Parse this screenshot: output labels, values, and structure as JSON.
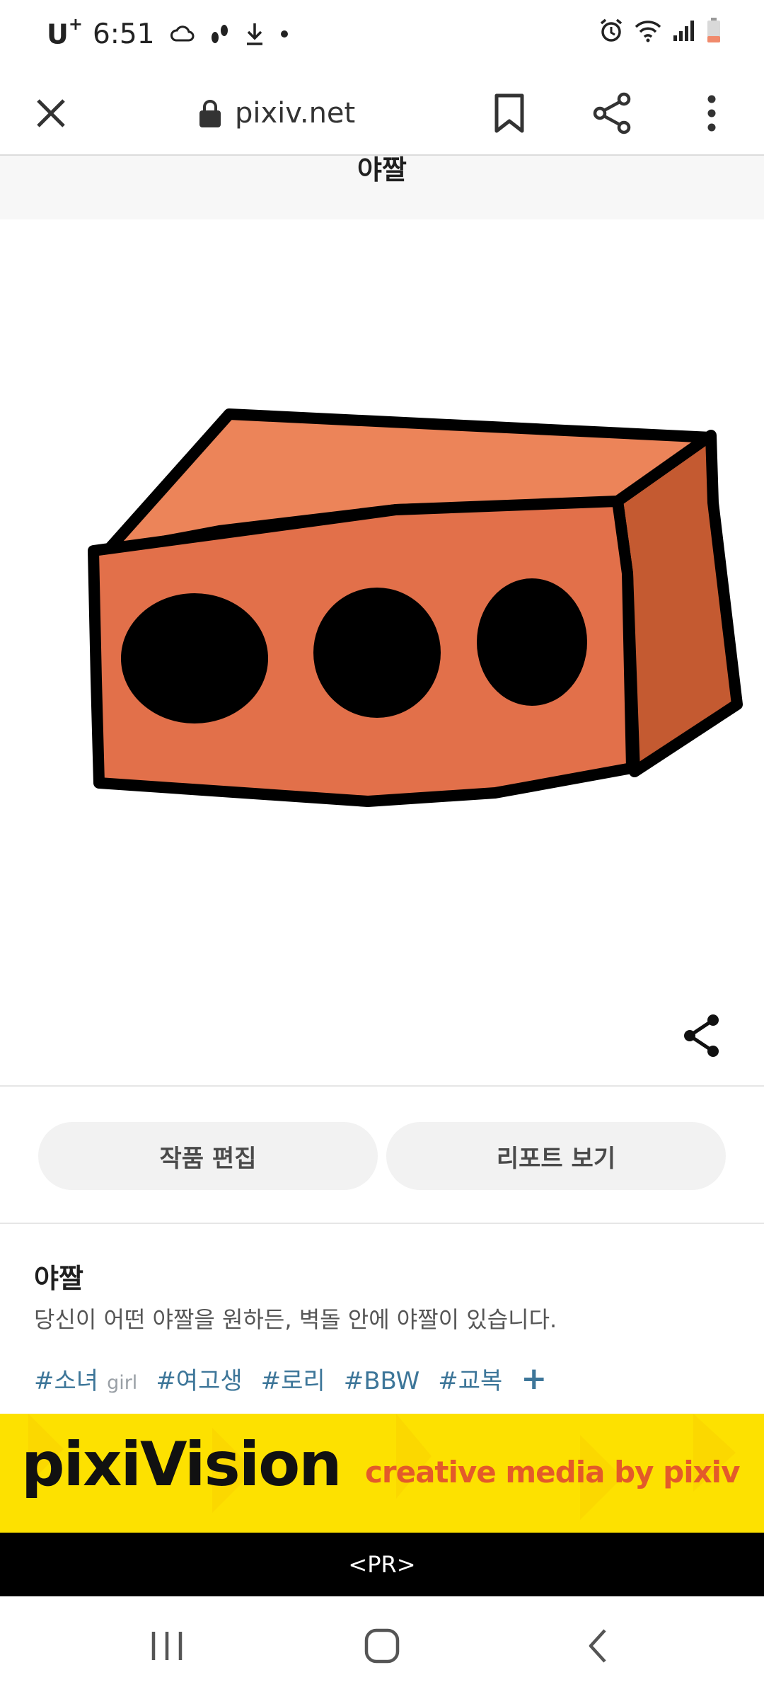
{
  "status_bar": {
    "carrier": "U",
    "carrier_plus": "+",
    "time": "6:51"
  },
  "browser": {
    "url": "pixiv.net",
    "icons": [
      "close-icon",
      "lock-icon",
      "bookmark-icon",
      "share-icon",
      "more-vert-icon"
    ]
  },
  "work": {
    "page_title": "야짤",
    "title": "야짤",
    "description": "당신이 어떤 야짤을 원하든, 벽돌 안에 야짤이 있습니다.",
    "artwork_subject": "brick-illustration",
    "colors": {
      "brick_front": "#e2704a",
      "brick_top": "#ec8459",
      "brick_side": "#c45a31",
      "outline": "#000000"
    }
  },
  "actions": {
    "edit_label": "작품 편집",
    "report_label": "리포트 보기"
  },
  "tags": [
    {
      "label": "#소녀",
      "translation": "girl"
    },
    {
      "label": "#여고생",
      "translation": ""
    },
    {
      "label": "#로리",
      "translation": ""
    },
    {
      "label": "#BBW",
      "translation": ""
    },
    {
      "label": "#교복",
      "translation": ""
    }
  ],
  "tag_add_label": "+",
  "banner": {
    "logo": "pixiVision",
    "tagline": "creative media by pixiv",
    "background": "#fde100",
    "tagline_color": "#e35a2a",
    "pr_label": "<PR>"
  },
  "nav": {
    "icons": [
      "recents-icon",
      "home-icon",
      "back-icon"
    ]
  }
}
